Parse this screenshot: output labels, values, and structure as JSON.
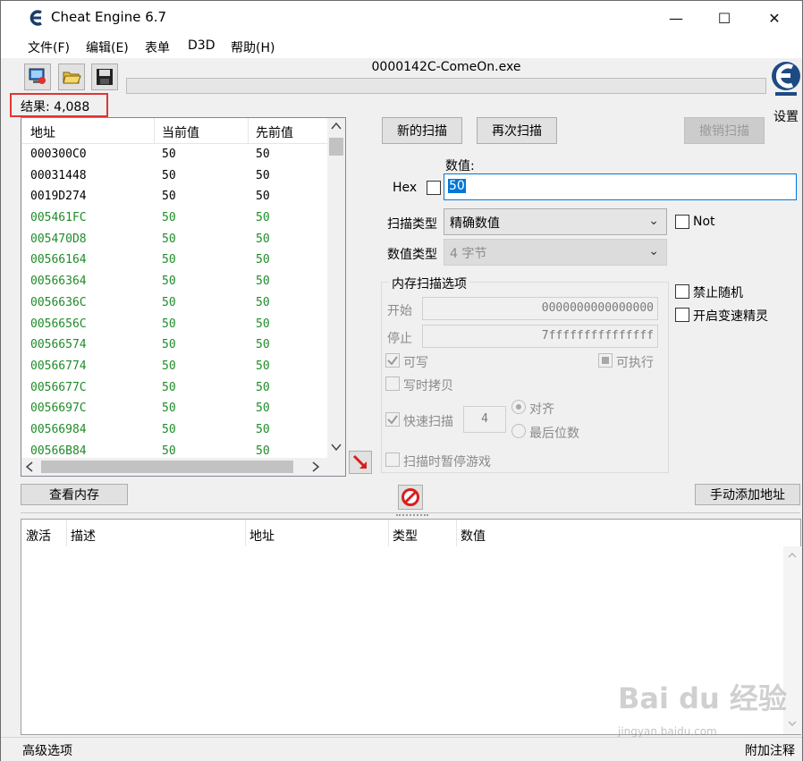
{
  "window": {
    "title": "Cheat Engine 6.7",
    "minimize": "—",
    "maximize": "☐",
    "close": "✕"
  },
  "menu": [
    "文件(F)",
    "编辑(E)",
    "表单",
    "D3D",
    "帮助(H)"
  ],
  "process_name": "0000142C-ComeOn.exe",
  "settings_label": "设置",
  "results_label": "结果: 4,088",
  "result_columns": [
    "地址",
    "当前值",
    "先前值"
  ],
  "results": [
    {
      "addr": "000300C0",
      "cur": "50",
      "prev": "50",
      "green": false
    },
    {
      "addr": "00031448",
      "cur": "50",
      "prev": "50",
      "green": false
    },
    {
      "addr": "0019D274",
      "cur": "50",
      "prev": "50",
      "green": false
    },
    {
      "addr": "005461FC",
      "cur": "50",
      "prev": "50",
      "green": true
    },
    {
      "addr": "005470D8",
      "cur": "50",
      "prev": "50",
      "green": true
    },
    {
      "addr": "00566164",
      "cur": "50",
      "prev": "50",
      "green": true
    },
    {
      "addr": "00566364",
      "cur": "50",
      "prev": "50",
      "green": true
    },
    {
      "addr": "0056636C",
      "cur": "50",
      "prev": "50",
      "green": true
    },
    {
      "addr": "0056656C",
      "cur": "50",
      "prev": "50",
      "green": true
    },
    {
      "addr": "00566574",
      "cur": "50",
      "prev": "50",
      "green": true
    },
    {
      "addr": "00566774",
      "cur": "50",
      "prev": "50",
      "green": true
    },
    {
      "addr": "0056677C",
      "cur": "50",
      "prev": "50",
      "green": true
    },
    {
      "addr": "0056697C",
      "cur": "50",
      "prev": "50",
      "green": true
    },
    {
      "addr": "00566984",
      "cur": "50",
      "prev": "50",
      "green": true
    },
    {
      "addr": "00566B84",
      "cur": "50",
      "prev": "50",
      "green": true
    }
  ],
  "buttons": {
    "new_scan": "新的扫描",
    "next_scan": "再次扫描",
    "undo_scan": "撤销扫描",
    "view_memory": "查看内存",
    "add_manual": "手动添加地址"
  },
  "value_label": "数值:",
  "hex_label": "Hex",
  "value_input": "50",
  "scan_type_label": "扫描类型",
  "scan_type_value": "精确数值",
  "value_type_label": "数值类型",
  "value_type_value": "4 字节",
  "not_label": "Not",
  "memory_options": {
    "title": "内存扫描选项",
    "start_label": "开始",
    "start_value": "0000000000000000",
    "stop_label": "停止",
    "stop_value": "7fffffffffffffff",
    "writable": "可写",
    "executable": "可执行",
    "copy_on_write": "写时拷贝",
    "fast_scan": "快速扫描",
    "fast_scan_value": "4",
    "align": "对齐",
    "last_digits": "最后位数",
    "pause_game": "扫描时暂停游戏"
  },
  "disable_random": "禁止随机",
  "speedhack": "开启变速精灵",
  "addr_columns": [
    "激活",
    "描述",
    "地址",
    "类型",
    "数值"
  ],
  "status": {
    "left": "高级选项",
    "right": "附加注释"
  },
  "watermark": "Bai du 经验",
  "watermark_sub": "jingyan.baidu.com"
}
